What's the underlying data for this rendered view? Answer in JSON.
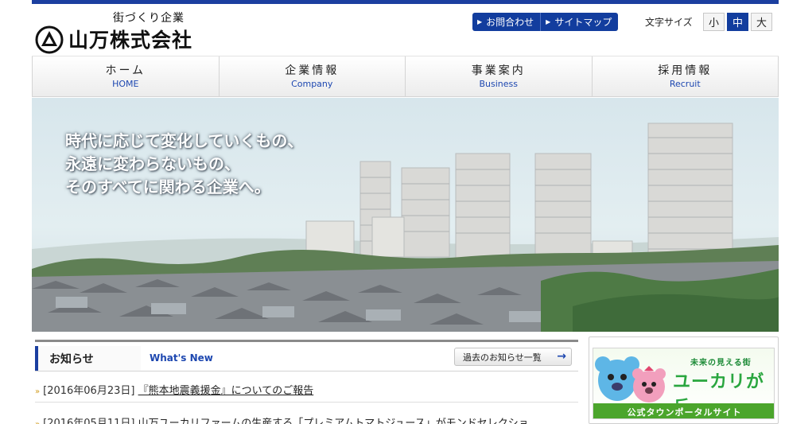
{
  "header": {
    "tagline": "街づくり企業",
    "company_name": "山万株式会社",
    "contact_label": "お問合わせ",
    "sitemap_label": "サイトマップ",
    "font_size_label": "文字サイズ",
    "font_sizes": [
      "小",
      "中",
      "大"
    ],
    "font_size_selected": "中"
  },
  "nav": {
    "items": [
      {
        "jp": "ホーム",
        "en": "HOME"
      },
      {
        "jp": "企業情報",
        "en": "Company"
      },
      {
        "jp": "事業案内",
        "en": "Business"
      },
      {
        "jp": "採用情報",
        "en": "Recruit"
      }
    ]
  },
  "hero": {
    "line1": "時代に応じて変化していくもの、",
    "line2": "永遠に変わらないもの、",
    "line3": "そのすべてに関わる企業へ。"
  },
  "news": {
    "title": "お知らせ",
    "subtitle": "What's New",
    "all_label": "過去のお知らせ一覧",
    "items": [
      {
        "date": "[2016年06月23日]",
        "text": "『熊本地震義援金』についてのご報告"
      },
      {
        "date": "[2016年05月11日]",
        "text": "山万ユーカリファームの生産する「プレミアムトマトジュース」がモンドセレクショ"
      }
    ]
  },
  "banner": {
    "tagline": "未来の見える街",
    "name": "ユーカリが丘",
    "footer": "公式タウンポータルサイト"
  },
  "colors": {
    "brand_blue": "#123d9e",
    "nav_en": "#1d47b0",
    "banner_green": "#4ba52c"
  }
}
